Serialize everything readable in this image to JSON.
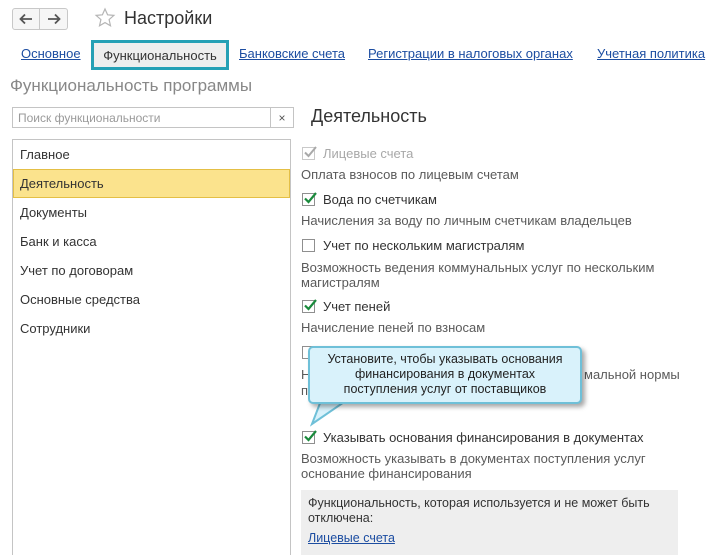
{
  "window": {
    "title": "Настройки"
  },
  "tabs": [
    {
      "label": "Основное",
      "active": false
    },
    {
      "label": "Функциональность",
      "active": true
    },
    {
      "label": "Банковские счета",
      "active": false
    },
    {
      "label": "Регистрации в налоговых органах",
      "active": false
    },
    {
      "label": "Учетная политика",
      "active": false
    }
  ],
  "section_title": "Функциональность программы",
  "search": {
    "placeholder": "Поиск функциональности",
    "value": "",
    "clear": "×"
  },
  "sidebar": {
    "items": [
      {
        "label": "Главное",
        "selected": false
      },
      {
        "label": "Деятельность",
        "selected": true
      },
      {
        "label": "Документы",
        "selected": false
      },
      {
        "label": "Банк и касса",
        "selected": false
      },
      {
        "label": "Учет по договорам",
        "selected": false
      },
      {
        "label": "Основные средства",
        "selected": false
      },
      {
        "label": "Сотрудники",
        "selected": false
      }
    ]
  },
  "panel": {
    "title": "Деятельность",
    "options": [
      {
        "label": "Лицевые счета",
        "checked": true,
        "disabled": true,
        "description": "Оплата взносов по лицевым счетам"
      },
      {
        "label": "Вода по счетчикам",
        "checked": true,
        "disabled": false,
        "description": "Начисления за воду по личным счетчикам владельцев"
      },
      {
        "label": "Учет по нескольким магистралям",
        "checked": false,
        "disabled": false,
        "description": "Возможность ведения коммунальных услуг по нескольким магистралям"
      },
      {
        "label": "Учет пеней",
        "checked": true,
        "disabled": false,
        "description": "Начисление пеней по взносам"
      },
      {
        "label": "",
        "checked": false,
        "disabled": false,
        "description_fragment_1": "Н",
        "description_fragment_2": "мальной нормы",
        "description_fragment_3": "п"
      },
      {
        "label": "Указывать основания финансирования в документах",
        "checked": true,
        "disabled": false,
        "description": "Возможность указывать в документах поступления услуг основание финансирования"
      }
    ],
    "tooltip": "Установите, чтобы указывать основания финансирования в документах поступления услуг от поставщиков",
    "info": {
      "text": "Функциональность, которая используется и не может быть отключена:",
      "link": "Лицевые счета"
    }
  },
  "colors": {
    "accent_tab_border": "#25a0b5",
    "selected_item": "#fbe38d",
    "link": "#1c4da1",
    "check": "#1a8a3c",
    "tooltip_bg": "#d9f2fb"
  }
}
